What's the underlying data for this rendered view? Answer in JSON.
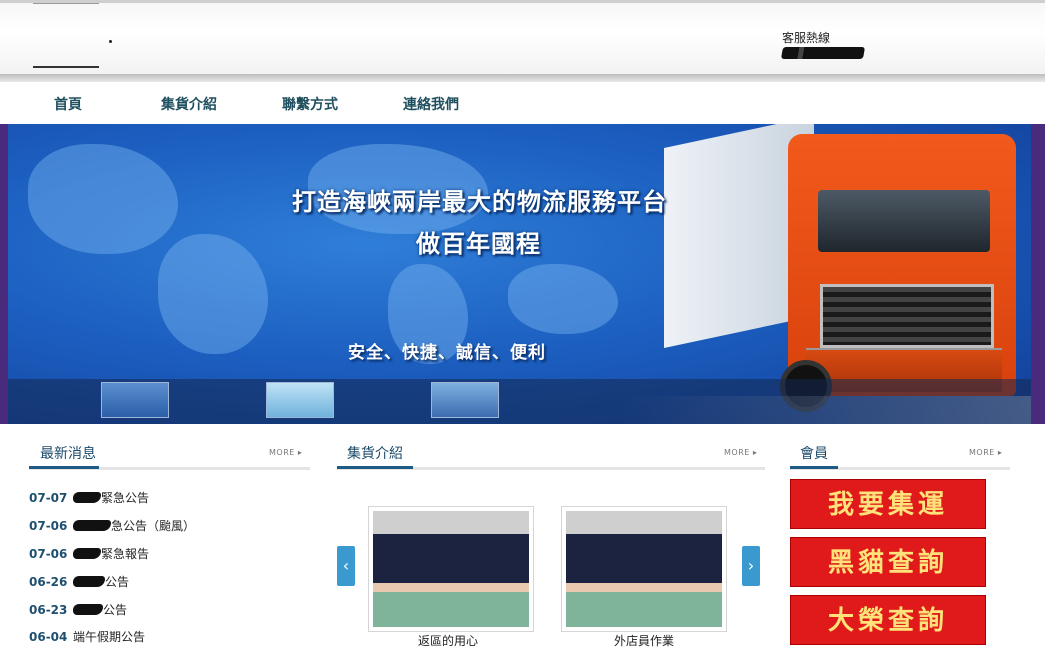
{
  "header": {
    "hotline_label": "客服熱線"
  },
  "nav": {
    "items": [
      {
        "label": "首頁"
      },
      {
        "label": "集貨介紹"
      },
      {
        "label": "聯繫方式"
      },
      {
        "label": "連絡我們"
      }
    ]
  },
  "banner": {
    "title_line1": "打造海峽兩岸最大的物流服務平台",
    "title_line2": "做百年國程",
    "slogan": "安全、快捷、誠信、便利"
  },
  "news": {
    "title": "最新消息",
    "more": "MORE ▸",
    "items": [
      {
        "date": "07-07",
        "text": "緊急公告"
      },
      {
        "date": "07-06",
        "text": "急公告（颱風）"
      },
      {
        "date": "07-06",
        "text": "緊急報告"
      },
      {
        "date": "06-26",
        "text": "公告"
      },
      {
        "date": "06-23",
        "text": "公告"
      },
      {
        "date": "06-04",
        "text": "端午假期公告"
      }
    ]
  },
  "intro": {
    "title": "集貨介紹",
    "more": "MORE ▸",
    "prev_icon": "‹",
    "next_icon": "›",
    "cards": [
      {
        "caption": "返區的用心"
      },
      {
        "caption": "外店員作業"
      }
    ]
  },
  "member": {
    "title": "會員",
    "more": "MORE ▸",
    "buttons": [
      {
        "label": "我要集運"
      },
      {
        "label": "黑貓查詢"
      },
      {
        "label": "大榮查詢"
      }
    ]
  },
  "colors": {
    "accent": "#1e5a86",
    "member_red": "#e01a1a",
    "arrow_blue": "#3a9ad0"
  }
}
